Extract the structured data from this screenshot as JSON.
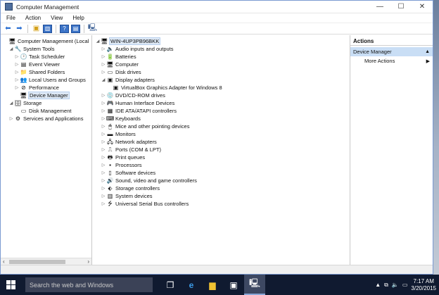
{
  "window": {
    "title": "Computer Management"
  },
  "menu": [
    "File",
    "Action",
    "View",
    "Help"
  ],
  "left_tree": [
    {
      "label": "Computer Management (Local",
      "indent": 0,
      "exp": "",
      "icon": "computer-management-icon",
      "glyph": "🖥"
    },
    {
      "label": "System Tools",
      "indent": 1,
      "exp": "◢",
      "icon": "system-tools-icon",
      "glyph": "🔧"
    },
    {
      "label": "Task Scheduler",
      "indent": 2,
      "exp": "▷",
      "icon": "task-scheduler-icon",
      "glyph": "🕑"
    },
    {
      "label": "Event Viewer",
      "indent": 2,
      "exp": "▷",
      "icon": "event-viewer-icon",
      "glyph": "▤"
    },
    {
      "label": "Shared Folders",
      "indent": 2,
      "exp": "▷",
      "icon": "shared-folders-icon",
      "glyph": "📁"
    },
    {
      "label": "Local Users and Groups",
      "indent": 2,
      "exp": "▷",
      "icon": "users-icon",
      "glyph": "👥"
    },
    {
      "label": "Performance",
      "indent": 2,
      "exp": "▷",
      "icon": "performance-icon",
      "glyph": "⊘"
    },
    {
      "label": "Device Manager",
      "indent": 2,
      "exp": "",
      "icon": "device-manager-icon",
      "glyph": "🖥",
      "selected": true
    },
    {
      "label": "Storage",
      "indent": 1,
      "exp": "◢",
      "icon": "storage-icon",
      "glyph": "🗄"
    },
    {
      "label": "Disk Management",
      "indent": 2,
      "exp": "",
      "icon": "disk-management-icon",
      "glyph": "▭"
    },
    {
      "label": "Services and Applications",
      "indent": 1,
      "exp": "▷",
      "icon": "services-icon",
      "glyph": "⚙"
    }
  ],
  "device_tree": [
    {
      "label": "WIN-4UP3PB96BKK",
      "indent": 0,
      "exp": "◢",
      "icon": "computer-icon",
      "glyph": "🖥",
      "selected": true
    },
    {
      "label": "Audio inputs and outputs",
      "indent": 1,
      "exp": "▷",
      "icon": "audio-icon",
      "glyph": "🔈"
    },
    {
      "label": "Batteries",
      "indent": 1,
      "exp": "▷",
      "icon": "battery-icon",
      "glyph": "🔋"
    },
    {
      "label": "Computer",
      "indent": 1,
      "exp": "▷",
      "icon": "computer-icon",
      "glyph": "🖥"
    },
    {
      "label": "Disk drives",
      "indent": 1,
      "exp": "▷",
      "icon": "disk-drive-icon",
      "glyph": "▭"
    },
    {
      "label": "Display adapters",
      "indent": 1,
      "exp": "◢",
      "icon": "display-adapter-icon",
      "glyph": "▣"
    },
    {
      "label": "VirtualBox Graphics Adapter for Windows 8",
      "indent": 2,
      "exp": "",
      "icon": "display-adapter-icon",
      "glyph": "▣"
    },
    {
      "label": "DVD/CD-ROM drives",
      "indent": 1,
      "exp": "▷",
      "icon": "dvd-icon",
      "glyph": "💿"
    },
    {
      "label": "Human Interface Devices",
      "indent": 1,
      "exp": "▷",
      "icon": "hid-icon",
      "glyph": "🎮"
    },
    {
      "label": "IDE ATA/ATAPI controllers",
      "indent": 1,
      "exp": "▷",
      "icon": "ide-controller-icon",
      "glyph": "▦"
    },
    {
      "label": "Keyboards",
      "indent": 1,
      "exp": "▷",
      "icon": "keyboard-icon",
      "glyph": "⌨"
    },
    {
      "label": "Mice and other pointing devices",
      "indent": 1,
      "exp": "▷",
      "icon": "mouse-icon",
      "glyph": "🖱"
    },
    {
      "label": "Monitors",
      "indent": 1,
      "exp": "▷",
      "icon": "monitor-icon",
      "glyph": "▬"
    },
    {
      "label": "Network adapters",
      "indent": 1,
      "exp": "▷",
      "icon": "network-icon",
      "glyph": "🖧"
    },
    {
      "label": "Ports (COM & LPT)",
      "indent": 1,
      "exp": "▷",
      "icon": "ports-icon",
      "glyph": "⎍"
    },
    {
      "label": "Print queues",
      "indent": 1,
      "exp": "▷",
      "icon": "printer-icon",
      "glyph": "🖶"
    },
    {
      "label": "Processors",
      "indent": 1,
      "exp": "▷",
      "icon": "processor-icon",
      "glyph": "▪"
    },
    {
      "label": "Software devices",
      "indent": 1,
      "exp": "▷",
      "icon": "software-device-icon",
      "glyph": "▯"
    },
    {
      "label": "Sound, video and game controllers",
      "indent": 1,
      "exp": "▷",
      "icon": "sound-icon",
      "glyph": "🔊"
    },
    {
      "label": "Storage controllers",
      "indent": 1,
      "exp": "▷",
      "icon": "storage-controller-icon",
      "glyph": "⬖"
    },
    {
      "label": "System devices",
      "indent": 1,
      "exp": "▷",
      "icon": "system-device-icon",
      "glyph": "▥"
    },
    {
      "label": "Universal Serial Bus controllers",
      "indent": 1,
      "exp": "▷",
      "icon": "usb-icon",
      "glyph": "⭍"
    }
  ],
  "actions": {
    "header": "Actions",
    "section": "Device Manager",
    "more": "More Actions"
  },
  "taskbar": {
    "search_placeholder": "Search the web and Windows",
    "time": "7:17 AM",
    "date": "3/20/2015"
  },
  "colors": {
    "selection": "#c9def5",
    "taskbar": "#101a30",
    "accent": "#3b73c7"
  }
}
